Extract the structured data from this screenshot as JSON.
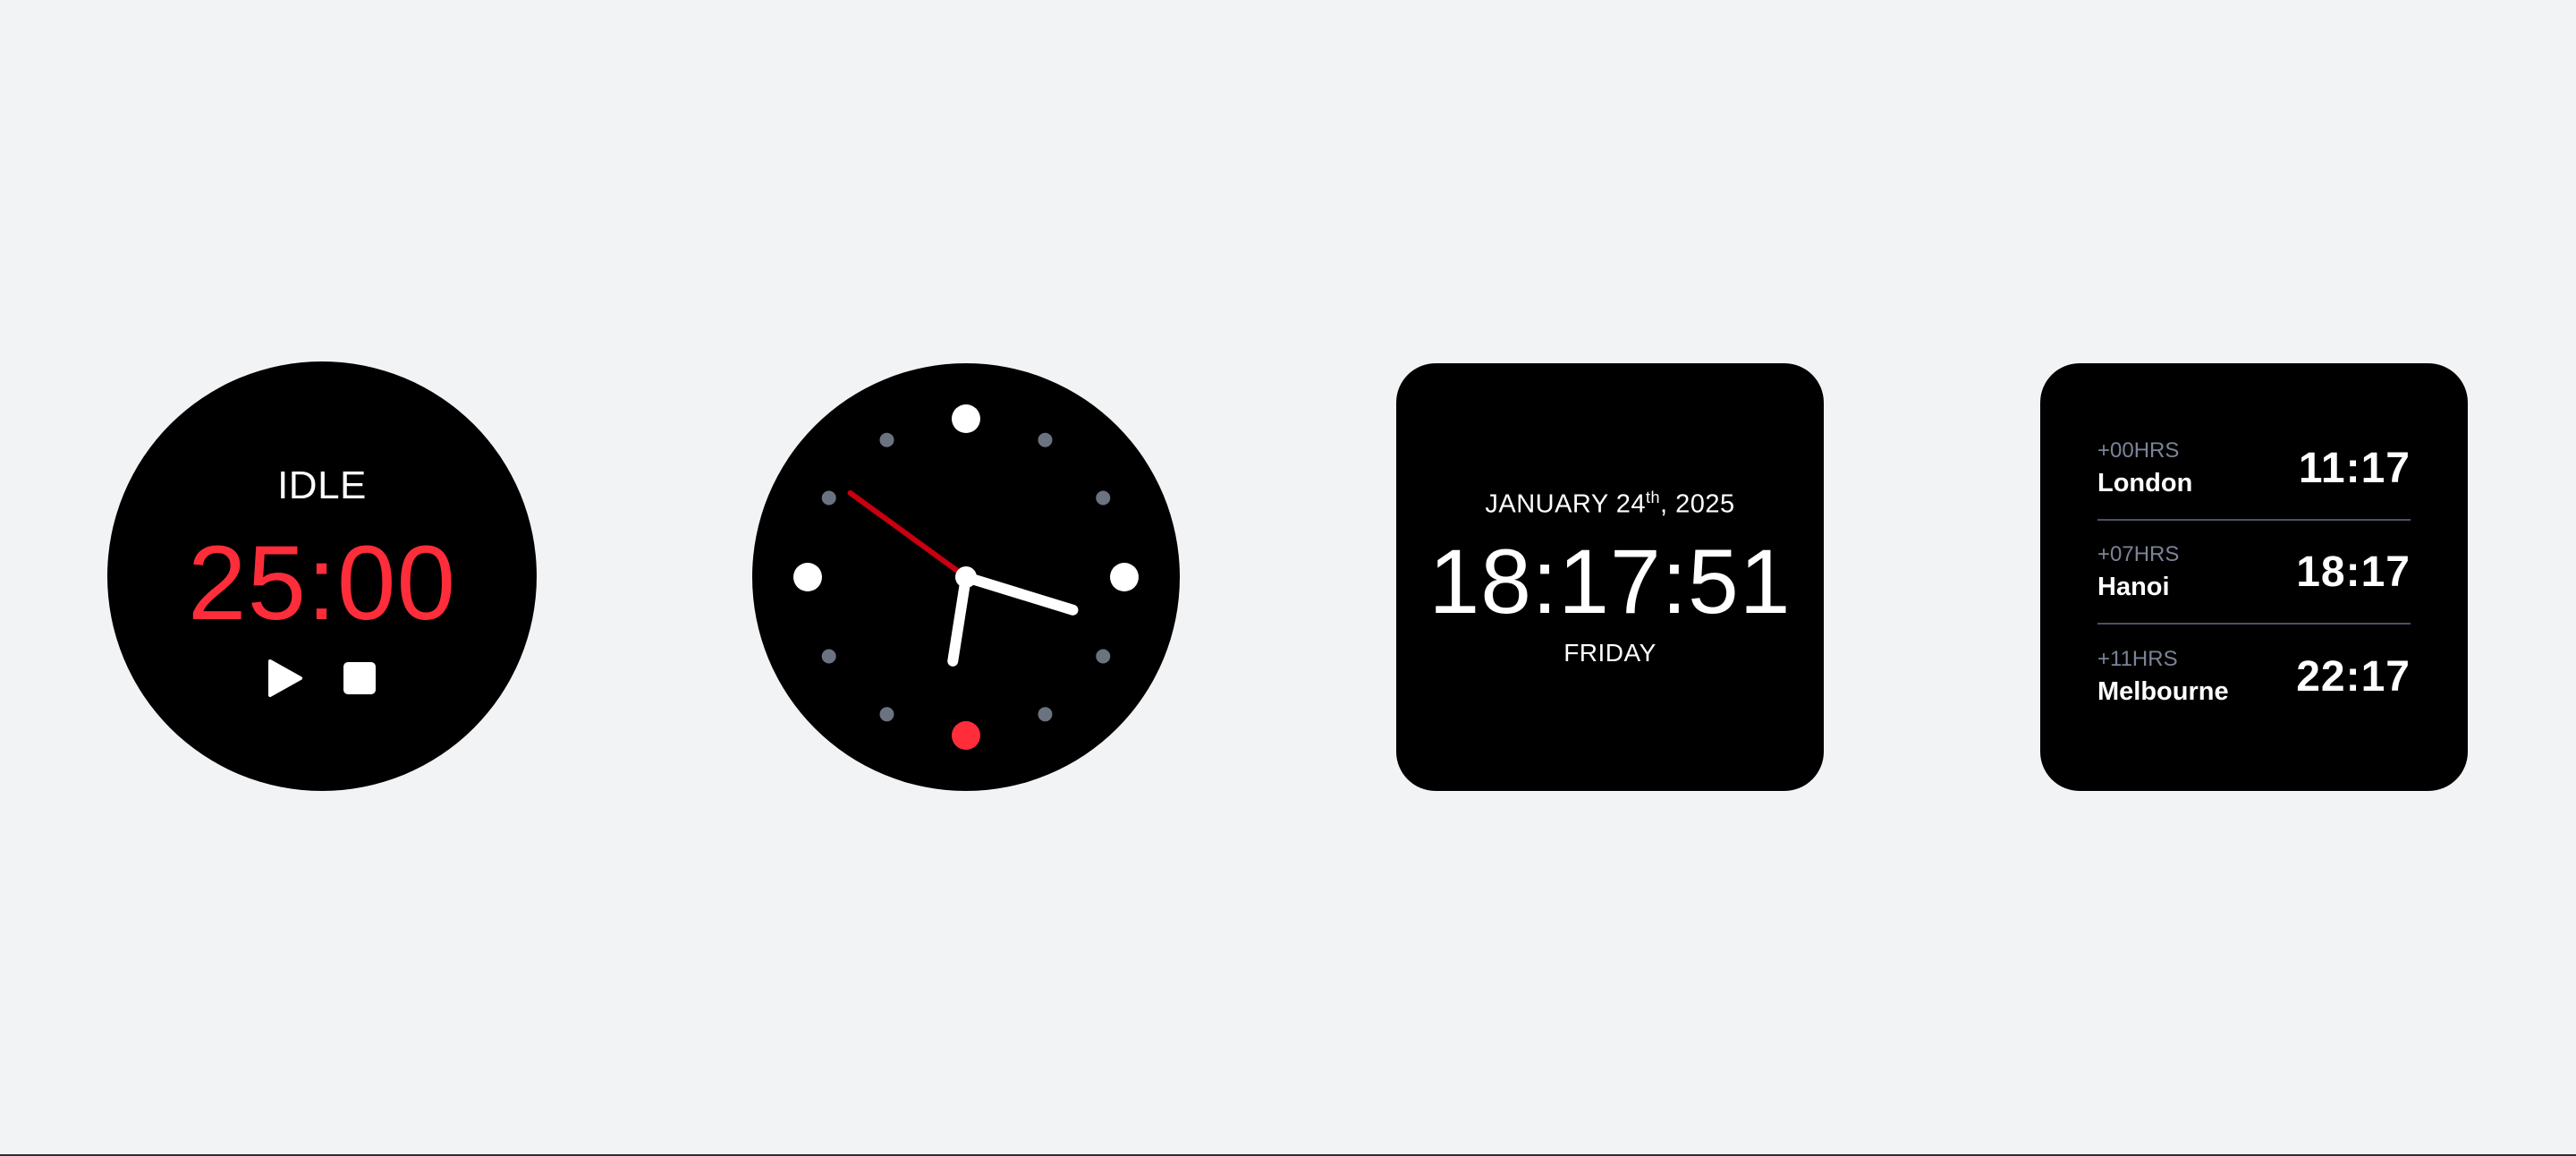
{
  "timer": {
    "status": "IDLE",
    "time": "25:00",
    "accent_color": "#ff2d3a",
    "controls": [
      {
        "icon": "play-icon"
      },
      {
        "icon": "stop-icon"
      }
    ]
  },
  "analog_clock": {
    "hours": 18,
    "minutes": 17,
    "seconds": 51,
    "second_hand_color": "#c8000f",
    "six_marker_color": "#ff2d3a",
    "minor_marker_color": "#6b7280"
  },
  "digital_clock": {
    "date_month_day": "JANUARY 24",
    "date_suffix": "th",
    "date_year": ", 2025",
    "time": "18:17:51",
    "day": "FRIDAY"
  },
  "world_clock": {
    "rows": [
      {
        "offset": "+00HRS",
        "city": "London",
        "time": "11:17"
      },
      {
        "offset": "+07HRS",
        "city": "Hanoi",
        "time": "18:17"
      },
      {
        "offset": "+11HRS",
        "city": "Melbourne",
        "time": "22:17"
      }
    ]
  }
}
